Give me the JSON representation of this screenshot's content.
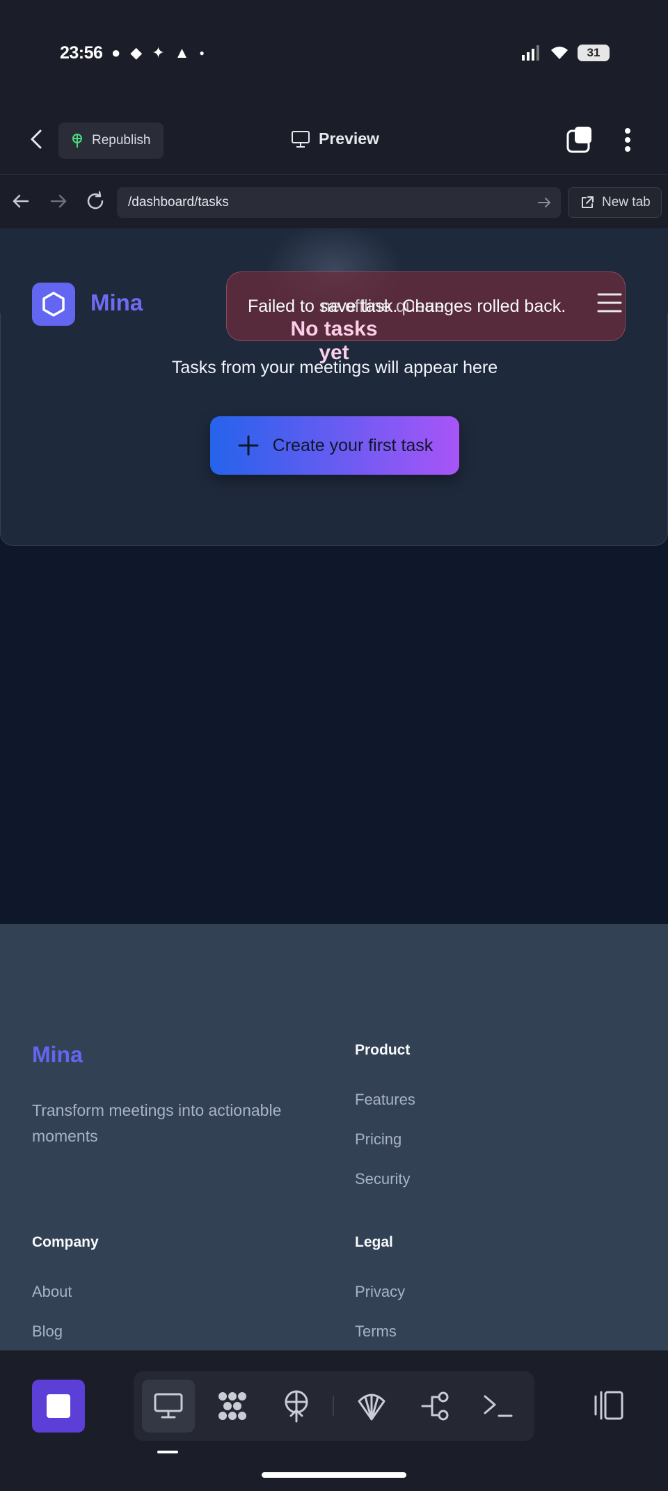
{
  "status_bar": {
    "time": "23:56",
    "battery": "31"
  },
  "app_bar": {
    "republish_label": "Republish",
    "preview_label": "Preview"
  },
  "browser": {
    "url": "/dashboard/tasks",
    "new_tab_label": "New tab"
  },
  "site": {
    "brand": "Mina"
  },
  "toast": {
    "message_a": "Failed to save task. Changes rolled back.",
    "message_b": "ne offline queue"
  },
  "empty_state": {
    "title": "No tasks yet",
    "subtitle": "Tasks from your meetings will appear here",
    "cta_label": "Create your first task"
  },
  "footer": {
    "brand": "Mina",
    "tagline": "Transform meetings into actionable moments",
    "product": {
      "heading": "Product",
      "links": [
        "Features",
        "Pricing",
        "Security"
      ]
    },
    "company": {
      "heading": "Company",
      "links": [
        "About",
        "Blog"
      ]
    },
    "legal": {
      "heading": "Legal",
      "links": [
        "Privacy",
        "Terms"
      ]
    }
  },
  "dock": {
    "tools": [
      "desktop-icon",
      "apps-icon",
      "deploy-icon",
      "shell-icon",
      "workflow-icon",
      "terminal-icon"
    ]
  },
  "colors": {
    "brand": "#6366f1",
    "cta_gradient_start": "#2563eb",
    "cta_gradient_end": "#a855f7",
    "page_bg": "#0f172a",
    "footer_bg": "#334155"
  }
}
